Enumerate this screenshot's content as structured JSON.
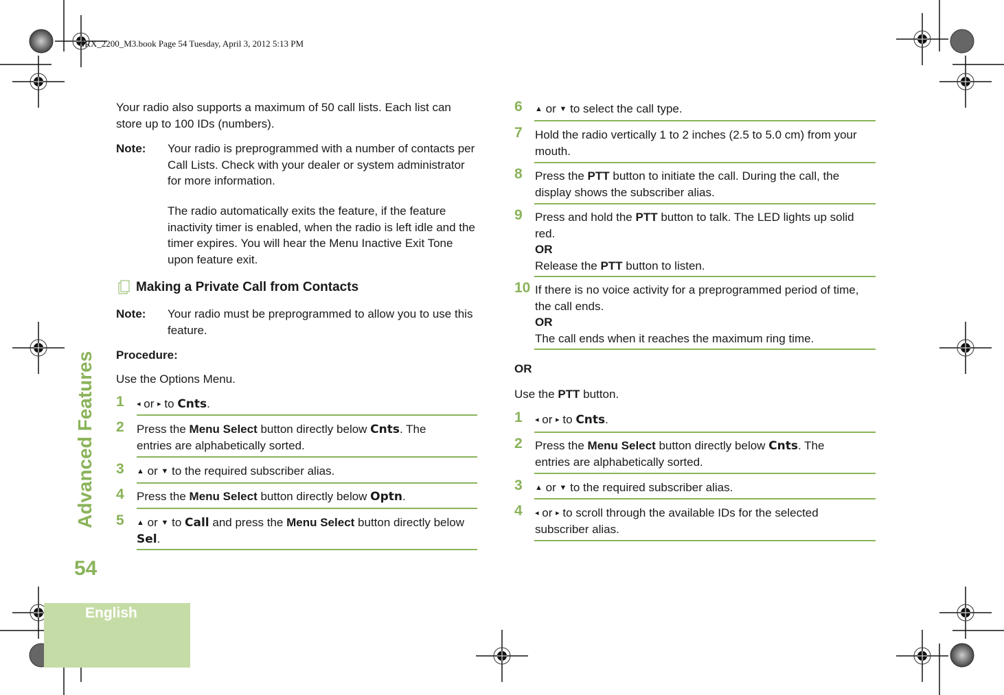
{
  "header": {
    "book_info": "SRX_2200_M3.book  Page 54  Tuesday, April 3, 2012  5:13 PM"
  },
  "sidebar": {
    "chapter_title": "Advanced Features",
    "page_number": "54",
    "language": "English"
  },
  "colors": {
    "accent": "#8ab35a",
    "language_box": "#c6dca6"
  },
  "icons": {
    "left": "◂",
    "right": "▸",
    "up": "▲",
    "down": "▼"
  },
  "left_column": {
    "intro": "Your radio also supports a maximum of 50 call lists. Each list can store up to 100 IDs (numbers).",
    "note1": {
      "label": "Note:",
      "text1": "Your radio is preprogrammed with a number of contacts per Call Lists. Check with your dealer or system administrator for more information.",
      "text2": "The radio automatically exits the feature, if the feature inactivity timer is enabled, when the radio is left idle and the timer expires. You will hear the Menu Inactive Exit Tone upon feature exit."
    },
    "section_title": "Making a Private Call from Contacts",
    "note2": {
      "label": "Note:",
      "text": "Your radio must be preprogrammed to allow you to use this feature."
    },
    "procedure_label": "Procedure:",
    "method_intro": "Use the Options Menu.",
    "steps": [
      {
        "num": "1",
        "or": "or",
        "to": "to",
        "lcd": "Cnts",
        "end": "."
      },
      {
        "num": "2",
        "pre": "Press the ",
        "bold": "Menu Select",
        "mid": " button directly below ",
        "lcd": "Cnts",
        "post": ". The entries are alphabetically sorted."
      },
      {
        "num": "3",
        "or": "or",
        "text": "to the required subscriber alias."
      },
      {
        "num": "4",
        "pre": "Press the ",
        "bold": "Menu Select",
        "mid": " button directly below ",
        "lcd": "Optn",
        "post": "."
      },
      {
        "num": "5",
        "or": "or",
        "to": "to",
        "lcd": "Call",
        "mid": " and press the ",
        "bold": "Menu Select",
        "mid2": " button directly below ",
        "lcd2": "Sel",
        "post": "."
      }
    ]
  },
  "right_column": {
    "steps": [
      {
        "num": "6",
        "or": "or",
        "text": "to select the call type."
      },
      {
        "num": "7",
        "text": "Hold the radio vertically 1 to 2 inches (2.5 to 5.0 cm) from your mouth."
      },
      {
        "num": "8",
        "pre": "Press the ",
        "bold": "PTT",
        "post": " button to initiate the call. During the call, the display shows the subscriber alias."
      },
      {
        "num": "9",
        "pre": "Press and hold the ",
        "bold": "PTT",
        "post": " button to talk. The LED lights up solid red.",
        "or_label": "OR",
        "alt_pre": "Release the ",
        "alt_bold": "PTT",
        "alt_post": " button to listen."
      },
      {
        "num": "10",
        "text": "If there is no voice activity for a preprogrammed period of time, the call ends.",
        "or_label": "OR",
        "alt": "The call ends when it reaches the maximum ring time."
      }
    ],
    "or_label": "OR",
    "method2_pre": "Use the ",
    "method2_bold": "PTT",
    "method2_post": " button.",
    "steps2": [
      {
        "num": "1",
        "or": "or",
        "to": "to",
        "lcd": "Cnts",
        "end": "."
      },
      {
        "num": "2",
        "pre": "Press the ",
        "bold": "Menu Select",
        "mid": " button directly below ",
        "lcd": "Cnts",
        "post": ". The entries are alphabetically sorted."
      },
      {
        "num": "3",
        "or": "or",
        "text": "to the required subscriber alias."
      },
      {
        "num": "4",
        "or": "or",
        "text": "to scroll through the available IDs for the selected subscriber alias."
      }
    ]
  }
}
